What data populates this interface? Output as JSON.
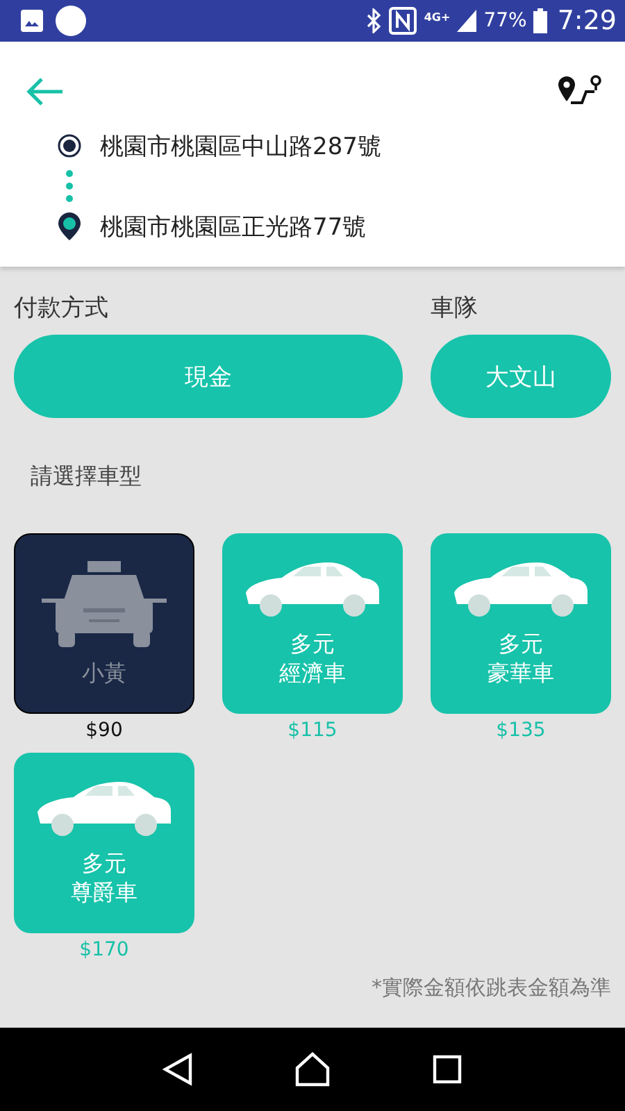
{
  "status_bar": {
    "network": "4G+",
    "battery": "77%",
    "time": "7:29"
  },
  "route": {
    "origin": "桃園市桃園區中山路287號",
    "destination": "桃園市桃園區正光路77號"
  },
  "payment": {
    "label": "付款方式",
    "value": "現金"
  },
  "fleet": {
    "label": "車隊",
    "value": "大文山"
  },
  "vehicle_prompt": "請選擇車型",
  "vehicles": [
    {
      "kind": "taxi",
      "lines": [
        "小黃"
      ],
      "price": "$90",
      "selected": true
    },
    {
      "kind": "sedan",
      "lines": [
        "多元",
        "經濟車"
      ],
      "price": "$115",
      "selected": false
    },
    {
      "kind": "sedan",
      "lines": [
        "多元",
        "豪華車"
      ],
      "price": "$135",
      "selected": false
    },
    {
      "kind": "sedan",
      "lines": [
        "多元",
        "尊爵車"
      ],
      "price": "$170",
      "selected": false
    }
  ],
  "note": "*實際金額依跳表金額為準"
}
